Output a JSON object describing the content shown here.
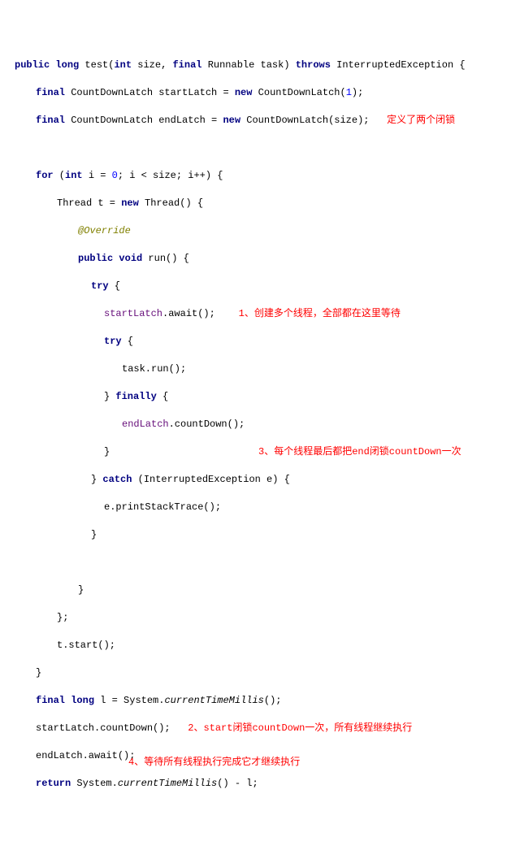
{
  "code": {
    "l1a": "public",
    "l1b": "long",
    "l1c": " test(",
    "l1d": "int",
    "l1e": " size, ",
    "l1f": "final",
    "l1g": " Runnable task) ",
    "l1h": "throws",
    "l1i": " InterruptedException {",
    "l2a": "final",
    "l2b": " CountDownLatch startLatch = ",
    "l2c": "new",
    "l2d": " CountDownLatch(",
    "l2n": "1",
    "l2e": ");",
    "l3a": "final",
    "l3b": " CountDownLatch endLatch = ",
    "l3c": "new",
    "l3d": " CountDownLatch(size);",
    "note1": "定义了两个闭锁",
    "l5a": "for",
    "l5b": " (",
    "l5c": "int",
    "l5d": " i = ",
    "l5n": "0",
    "l5e": "; i < size; i++) {",
    "l6a": "Thread t = ",
    "l6b": "new",
    "l6c": " Thread() {",
    "l7": "@Override",
    "l8a": "public",
    "l8b": "void",
    "l8c": " run() {",
    "l9": "try",
    "l9b": " {",
    "l10a": "startLatch",
    "l10b": ".await();",
    "note2": "1、创建多个线程，全部都在这里等待",
    "l11": "try",
    "l11b": " {",
    "l12": "task.run();",
    "l13a": "} ",
    "l13b": "finally",
    "l13c": " {",
    "l14a": "endLatch",
    "l14b": ".countDown();",
    "note3": "3、每个线程最后都把end闭锁countDown一次",
    "l15": "}",
    "l16a": "} ",
    "l16b": "catch",
    "l16c": " (InterruptedException e) {",
    "l17": "e.printStackTrace();",
    "l18": "}",
    "l20": "}",
    "l21": "};",
    "l22": "t.start();",
    "l23": "}",
    "l24a": "final",
    "l24b": "long",
    "l24c": " l = System.",
    "l24d": "currentTimeMillis",
    "l24e": "();",
    "l25": "startLatch.countDown();",
    "note4": "2、start闭锁countDown一次，所有线程继续执行",
    "l26": "endLatch.await();",
    "note5": "4、等待所有线程执行完成它才继续执行",
    "l27a": "return",
    "l27b": " System.",
    "l27c": "currentTimeMillis",
    "l27d": "() - l;"
  }
}
